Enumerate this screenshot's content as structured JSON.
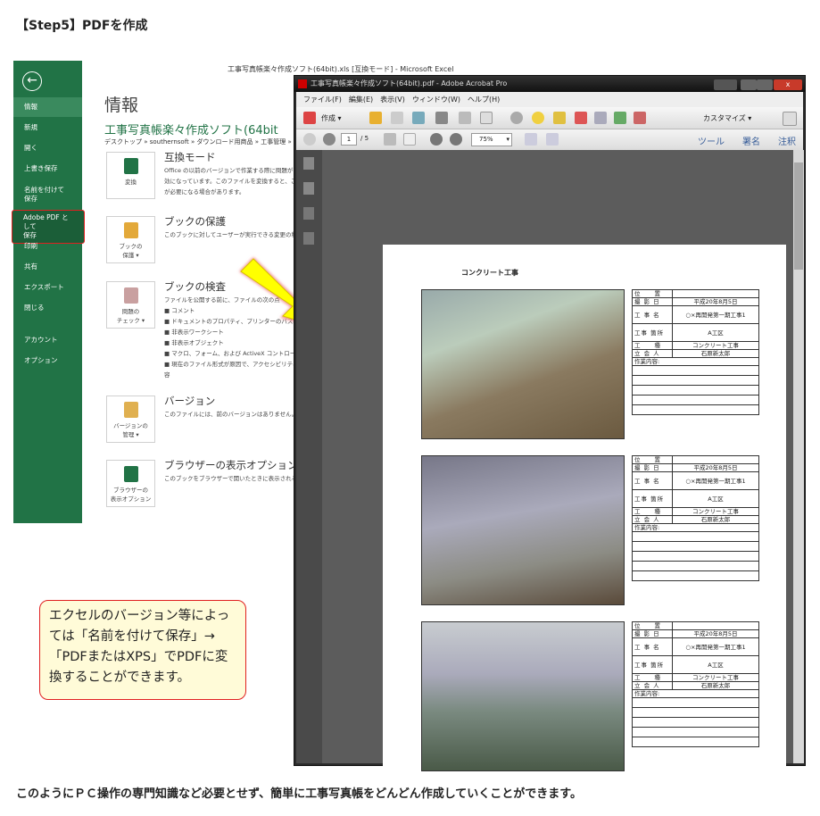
{
  "heading": "【Step5】PDFを作成",
  "excel": {
    "window_title": "工事写真帳楽々作成ソフト(64bit).xls [互換モード] - Microsoft Excel",
    "sidebar": [
      "情報",
      "新規",
      "開く",
      "上書き保存",
      "名前を付けて\n保存",
      "Adobe PDF として\n保存",
      "印刷",
      "共有",
      "エクスポート",
      "閉じる",
      "アカウント",
      "オプション"
    ],
    "page_title": "情報",
    "file_title": "工事写真帳楽々作成ソフト(64bit",
    "path": "デスクトップ » southernsoft » ダウンロード用商品 » 工事管理 »",
    "sections": [
      {
        "button": "変換",
        "title": "互換モード",
        "desc": [
          "Office の以前のバージョンで作業する際に問題が",
          "効になっています。このファイルを変換すると、これらの",
          "が必要になる場合があります。"
        ]
      },
      {
        "button": "ブックの\n保護 ▾",
        "title": "ブックの保護",
        "desc": [
          "このブックに対してユーザーが実行できる変更の種類"
        ]
      },
      {
        "button": "問題の\nチェック ▾",
        "title": "ブックの検査",
        "desc": [
          "ファイルを公開する前に、ファイルの次の点",
          "■ コメント",
          "■ ドキュメントのプロパティ、プリンターのパス、作",
          "■ 非表示ワークシート",
          "■ 非表示オブジェクト",
          "■ マクロ、フォーム、および ActiveX コントロール",
          "■ 現在のファイル形式が原因で、アクセシビリティ",
          "容"
        ]
      },
      {
        "button": "バージョンの\n管理 ▾",
        "title": "バージョン",
        "desc": [
          "このファイルには、前のバージョンはありません。"
        ]
      },
      {
        "button": "ブラウザーの\n表示オプション",
        "title": "ブラウザーの表示オプション",
        "desc": [
          "このブックをブラウザーで開いたときに表示される"
        ]
      }
    ]
  },
  "acrobat": {
    "title": "工事写真帳楽々作成ソフト(64bit).pdf - Adobe Acrobat Pro",
    "menu": [
      "ファイル(F)",
      "編集(E)",
      "表示(V)",
      "ウィンドウ(W)",
      "ヘルプ(H)"
    ],
    "create": "作成 ▾",
    "customize": "カスタマイズ ▾",
    "page_current": "1",
    "page_total": "/ 5",
    "zoom": "75%",
    "tabs": [
      "ツール",
      "署名",
      "注釈"
    ],
    "doc_heading": "コンクリート工事",
    "records": [
      {
        "rows": [
          [
            "位　　置",
            ""
          ],
          [
            "撮 影 日",
            "平成20年8月5日"
          ],
          [
            "工 事 名",
            "○×再開発第一期工事1"
          ],
          [
            "工事 箇所",
            "A工区"
          ],
          [
            "工　　種",
            "コンクリート工事"
          ],
          [
            "立 会 人",
            "石原新太郎"
          ]
        ],
        "notes": "作業内容:"
      },
      {
        "rows": [
          [
            "位　　置",
            ""
          ],
          [
            "撮 影 日",
            "平成20年8月5日"
          ],
          [
            "工 事 名",
            "○×再開発第一期工事1"
          ],
          [
            "工事 箇所",
            "A工区"
          ],
          [
            "工　　種",
            "コンクリート工事"
          ],
          [
            "立 会 人",
            "石原新太郎"
          ]
        ],
        "notes": "作業内容:"
      },
      {
        "rows": [
          [
            "位　　置",
            ""
          ],
          [
            "撮 影 日",
            "平成20年8月5日"
          ],
          [
            "工 事 名",
            "○×再開発第一期工事1"
          ],
          [
            "工事 箇所",
            "A工区"
          ],
          [
            "工　　種",
            "コンクリート工事"
          ],
          [
            "立 会 人",
            "石原新太郎"
          ]
        ],
        "notes": "作業内容:"
      }
    ]
  },
  "callout": "エクセルのバージョン等によっては「名前を付けて保存」→「PDFまたはXPS」でPDFに変換することができます。",
  "footer": "このようにＰＣ操作の専門知識など必要とせず、簡単に工事写真帳をどんどん作成していくことができます。"
}
